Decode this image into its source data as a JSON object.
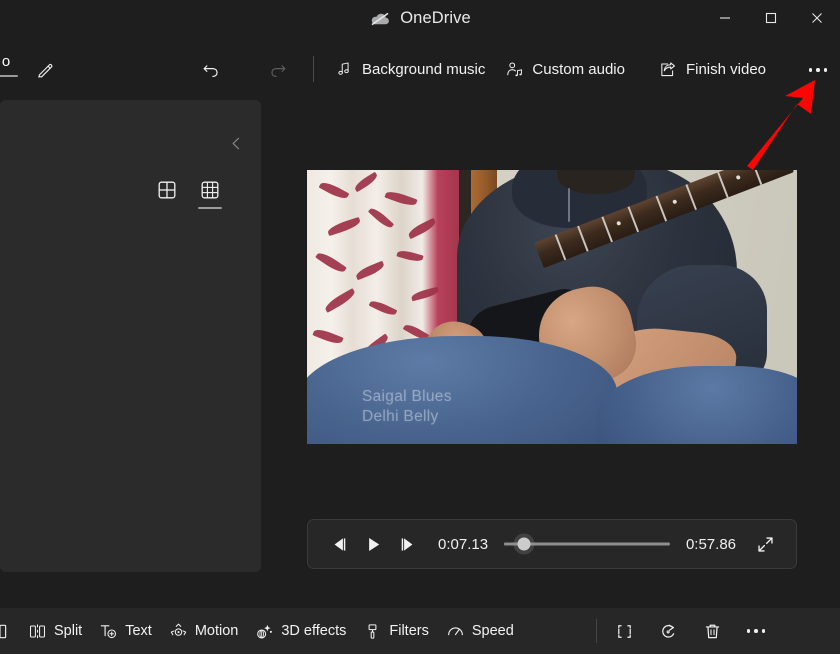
{
  "window": {
    "title": "OneDrive",
    "onedrive_icon": "cloud-paused-icon",
    "controls": {
      "minimize": "minimize-icon",
      "maximize": "maximize-icon",
      "close": "close-icon"
    }
  },
  "ribbon": {
    "tab_label": "o",
    "edit_icon": "pencil-icon",
    "undo_icon": "undo-icon",
    "redo_icon": "redo-icon",
    "items": [
      {
        "label": "Background music",
        "icon": "music-note-icon"
      },
      {
        "label": "Custom audio",
        "icon": "person-audio-icon"
      },
      {
        "label": "Finish video",
        "icon": "share-export-icon"
      }
    ],
    "more_label": "more-options-icon"
  },
  "left_panel": {
    "collapse_icon": "chevron-left-icon",
    "view_toggles": [
      {
        "name": "grid-2x2",
        "icon": "grid-large-icon",
        "active": false
      },
      {
        "name": "grid-3x3",
        "icon": "grid-small-icon",
        "active": true
      }
    ]
  },
  "preview": {
    "caption_line1": "Saigal Blues",
    "caption_line2": "Delhi Belly"
  },
  "player": {
    "prev_frame_icon": "previous-frame-icon",
    "play_icon": "play-icon",
    "next_frame_icon": "next-frame-icon",
    "current_time": "0:07.13",
    "total_time": "0:57.86",
    "seek_percent": 12,
    "fullscreen_icon": "fullscreen-icon"
  },
  "bottom_toolbar": {
    "items": [
      {
        "label": "Split",
        "icon": "split-icon"
      },
      {
        "label": "Text",
        "icon": "text-icon"
      },
      {
        "label": "Motion",
        "icon": "motion-icon"
      },
      {
        "label": "3D effects",
        "icon": "3d-effects-icon"
      },
      {
        "label": "Filters",
        "icon": "filters-icon"
      },
      {
        "label": "Speed",
        "icon": "speed-icon"
      }
    ],
    "right_icons": [
      {
        "name": "crop-resize-icon"
      },
      {
        "name": "rotate-icon"
      },
      {
        "name": "delete-icon"
      },
      {
        "name": "more-options-icon"
      }
    ]
  },
  "annotation": {
    "arrow_color": "#fb0505",
    "points_to": "ribbon-more-options-button"
  },
  "colors": {
    "window_bg": "#1e1e1e",
    "panel_bg": "#2b2b2b",
    "toolbar_bg": "#272727",
    "text": "#f2f2f2",
    "accent_underline": "#9a9a9a"
  }
}
